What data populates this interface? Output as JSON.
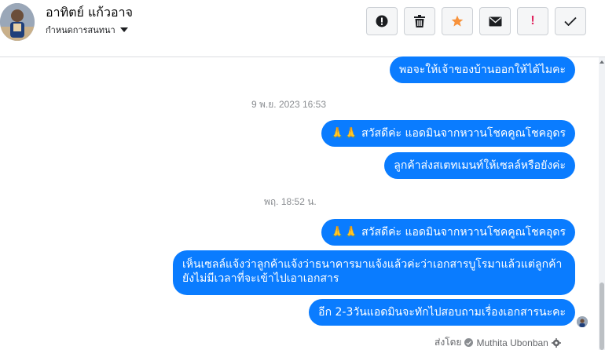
{
  "header": {
    "contact_name": "อาทิตย์ แก้วอาจ",
    "assign_label": "กำหนดการสนทนา"
  },
  "toolbar": {
    "icons": [
      "alert-circle-icon",
      "trash-icon",
      "star-icon",
      "envelope-icon",
      "exclamation-icon",
      "checkmark-icon"
    ],
    "star_color": "#f7923b",
    "exclamation_color": "#e0245e",
    "exclamation_label": "!"
  },
  "conversation": {
    "messages": [
      {
        "kind": "bubble",
        "text": "พอจะให้เจ้าของบ้านออกให้ได้ไมคะ"
      },
      {
        "kind": "timestamp",
        "text": "9 พ.ย. 2023 16:53"
      },
      {
        "kind": "bubble",
        "emoji": "🙏🙏",
        "text": " สวัสดีค่ะ แอดมินจากหวานโชคคูณโชคอุดร"
      },
      {
        "kind": "bubble",
        "text": "ลูกค้าส่งสเตทเมนท์ให้เซลล์หรือยังค่ะ"
      },
      {
        "kind": "timestamp",
        "text": "พฤ. 18:52 น."
      },
      {
        "kind": "bubble",
        "emoji": "🙏🙏",
        "text": " สวัสดีค่ะ แอดมินจากหวานโชคคูณโชคอุดร"
      },
      {
        "kind": "bubble",
        "text": "เห็นเซลล์แจ้งว่าลูกค้าแจ้งว่าธนาคารมาแจ้งแล้วค่ะว่าเอกสารบูโรมาแล้วแต่ลูกค้ายังไม่มีเวลาที่จะเข้าไปเอาเอกสาร"
      },
      {
        "kind": "bubble",
        "text": "อีก 2-3วันแอดมินจะทักไปสอบถามเรื่องเอกสารนะคะ"
      }
    ],
    "sent_by_label": "ส่งโดย",
    "sent_by_name": "Muthita Ubonban"
  },
  "colors": {
    "bubble": "#0a7cff",
    "timestamp": "#8a8d91"
  }
}
